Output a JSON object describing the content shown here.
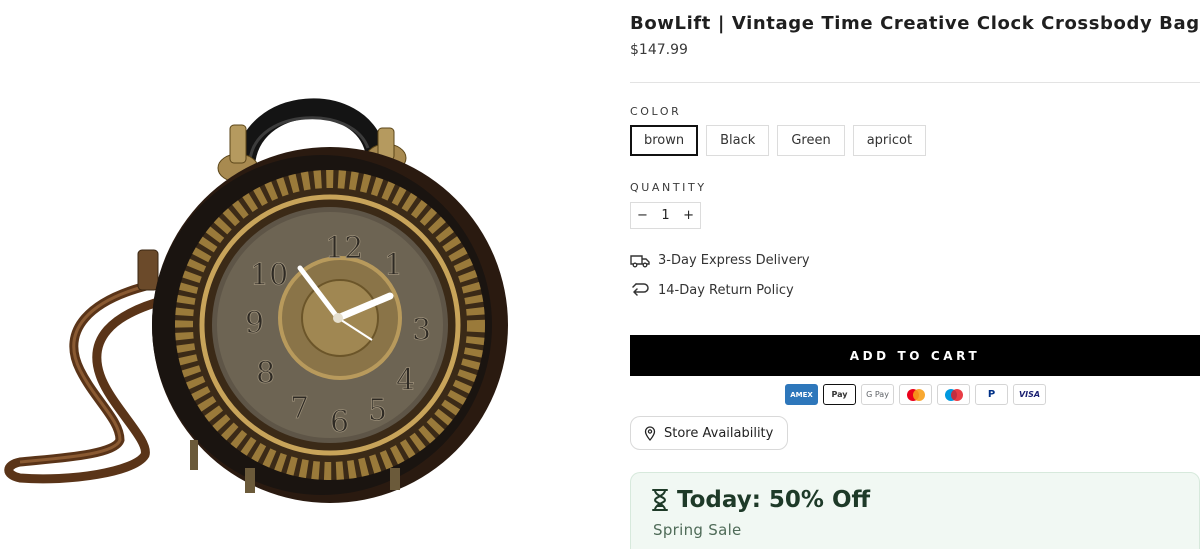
{
  "product": {
    "title": "BowLift | Vintage Time Creative Clock Crossbody Bag",
    "price": "$147.99",
    "image_alt": "clock crossbody bag photo"
  },
  "options": {
    "color_label": "COLOR",
    "colors": [
      "brown",
      "Black",
      "Green",
      "apricot"
    ],
    "selected_color": "brown",
    "quantity_label": "QUANTITY",
    "quantity_value": "1",
    "decrement": "−",
    "increment": "+"
  },
  "perks": {
    "delivery": "3-Day Express Delivery",
    "returns": "14-Day Return Policy"
  },
  "cart": {
    "add_label": "ADD TO CART"
  },
  "payments": [
    "AMEX",
    "Pay",
    "G Pay",
    "",
    "",
    "P",
    "VISA"
  ],
  "store": {
    "label": "Store Availability"
  },
  "promo": {
    "headline": "Today: 50% Off",
    "subline": "Spring Sale"
  },
  "colors": {
    "accent": "#000000",
    "promo_bg": "#f1f8f3",
    "promo_text": "#1e3a28"
  }
}
